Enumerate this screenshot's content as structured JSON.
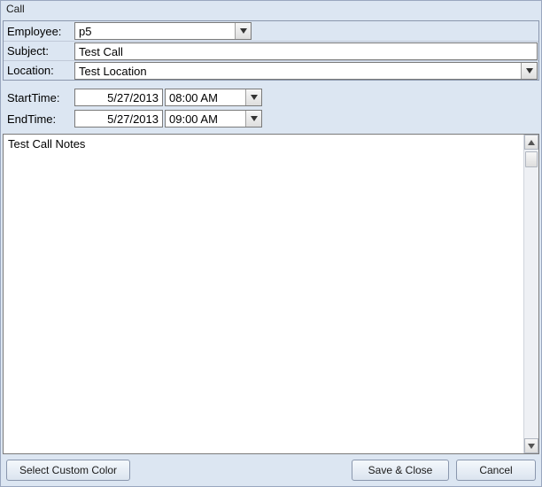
{
  "window": {
    "title": "Call"
  },
  "fields": {
    "employee": {
      "label": "Employee:",
      "value": "p5"
    },
    "subject": {
      "label": "Subject:",
      "value": "Test Call"
    },
    "location": {
      "label": "Location:",
      "value": "Test Location"
    },
    "start": {
      "label": "StartTime:",
      "date": "5/27/2013",
      "time": "08:00 AM"
    },
    "end": {
      "label": "EndTime:",
      "date": "5/27/2013",
      "time": "09:00 AM"
    }
  },
  "notes": "Test Call Notes",
  "buttons": {
    "custom_color": "Select Custom Color",
    "save_close": "Save & Close",
    "cancel": "Cancel"
  }
}
